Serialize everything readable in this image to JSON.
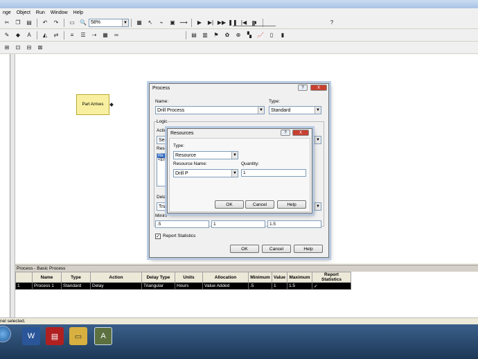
{
  "menu": [
    "nge",
    "Object",
    "Run",
    "Window",
    "Help"
  ],
  "toolbar": {
    "zoom": "58%"
  },
  "canvas": {
    "module_label": "Part Arrives"
  },
  "process_dialog": {
    "title": "Process",
    "help_btn": "?",
    "close_btn": "X",
    "name_label": "Name:",
    "name_value": "Drill Process",
    "type_label": "Type:",
    "type_value": "Standard",
    "logic_label": "Logic",
    "action_label": "Actio",
    "action_value": "Seiz",
    "resources_label": "Reso",
    "res_list": [
      "Re",
      "<En"
    ],
    "delay_label": "Dela",
    "delay_value": "Tria",
    "min_label": "Minim",
    "min_value": ".5",
    "value_value": "1",
    "max_value": "1.5",
    "report_label": "Report Statistics",
    "report_checked": "✓",
    "ok": "OK",
    "cancel": "Cancel",
    "help": "Help"
  },
  "resources_dialog": {
    "title": "Resources",
    "help_btn": "?",
    "close_btn": "X",
    "type_label": "Type:",
    "type_value": "Resource",
    "res_name_label": "Resource Name:",
    "res_name_value": "Drill P",
    "qty_label": "Quantity:",
    "qty_value": "1",
    "ok": "OK",
    "cancel": "Cancel",
    "help": "Help"
  },
  "grid": {
    "title": "Process - Basic Process",
    "headers": [
      "",
      "Name",
      "Type",
      "Action",
      "Delay Type",
      "Units",
      "Allocation",
      "Minimum",
      "Value",
      "Maximum",
      "Report Statistics"
    ],
    "row": [
      "1",
      "Process 1",
      "Standard",
      "Delay",
      "Triangular",
      "Hours",
      "Value Added",
      ".5",
      "1",
      "1.5",
      "✓"
    ]
  },
  "status": {
    "text": "nel selected."
  }
}
